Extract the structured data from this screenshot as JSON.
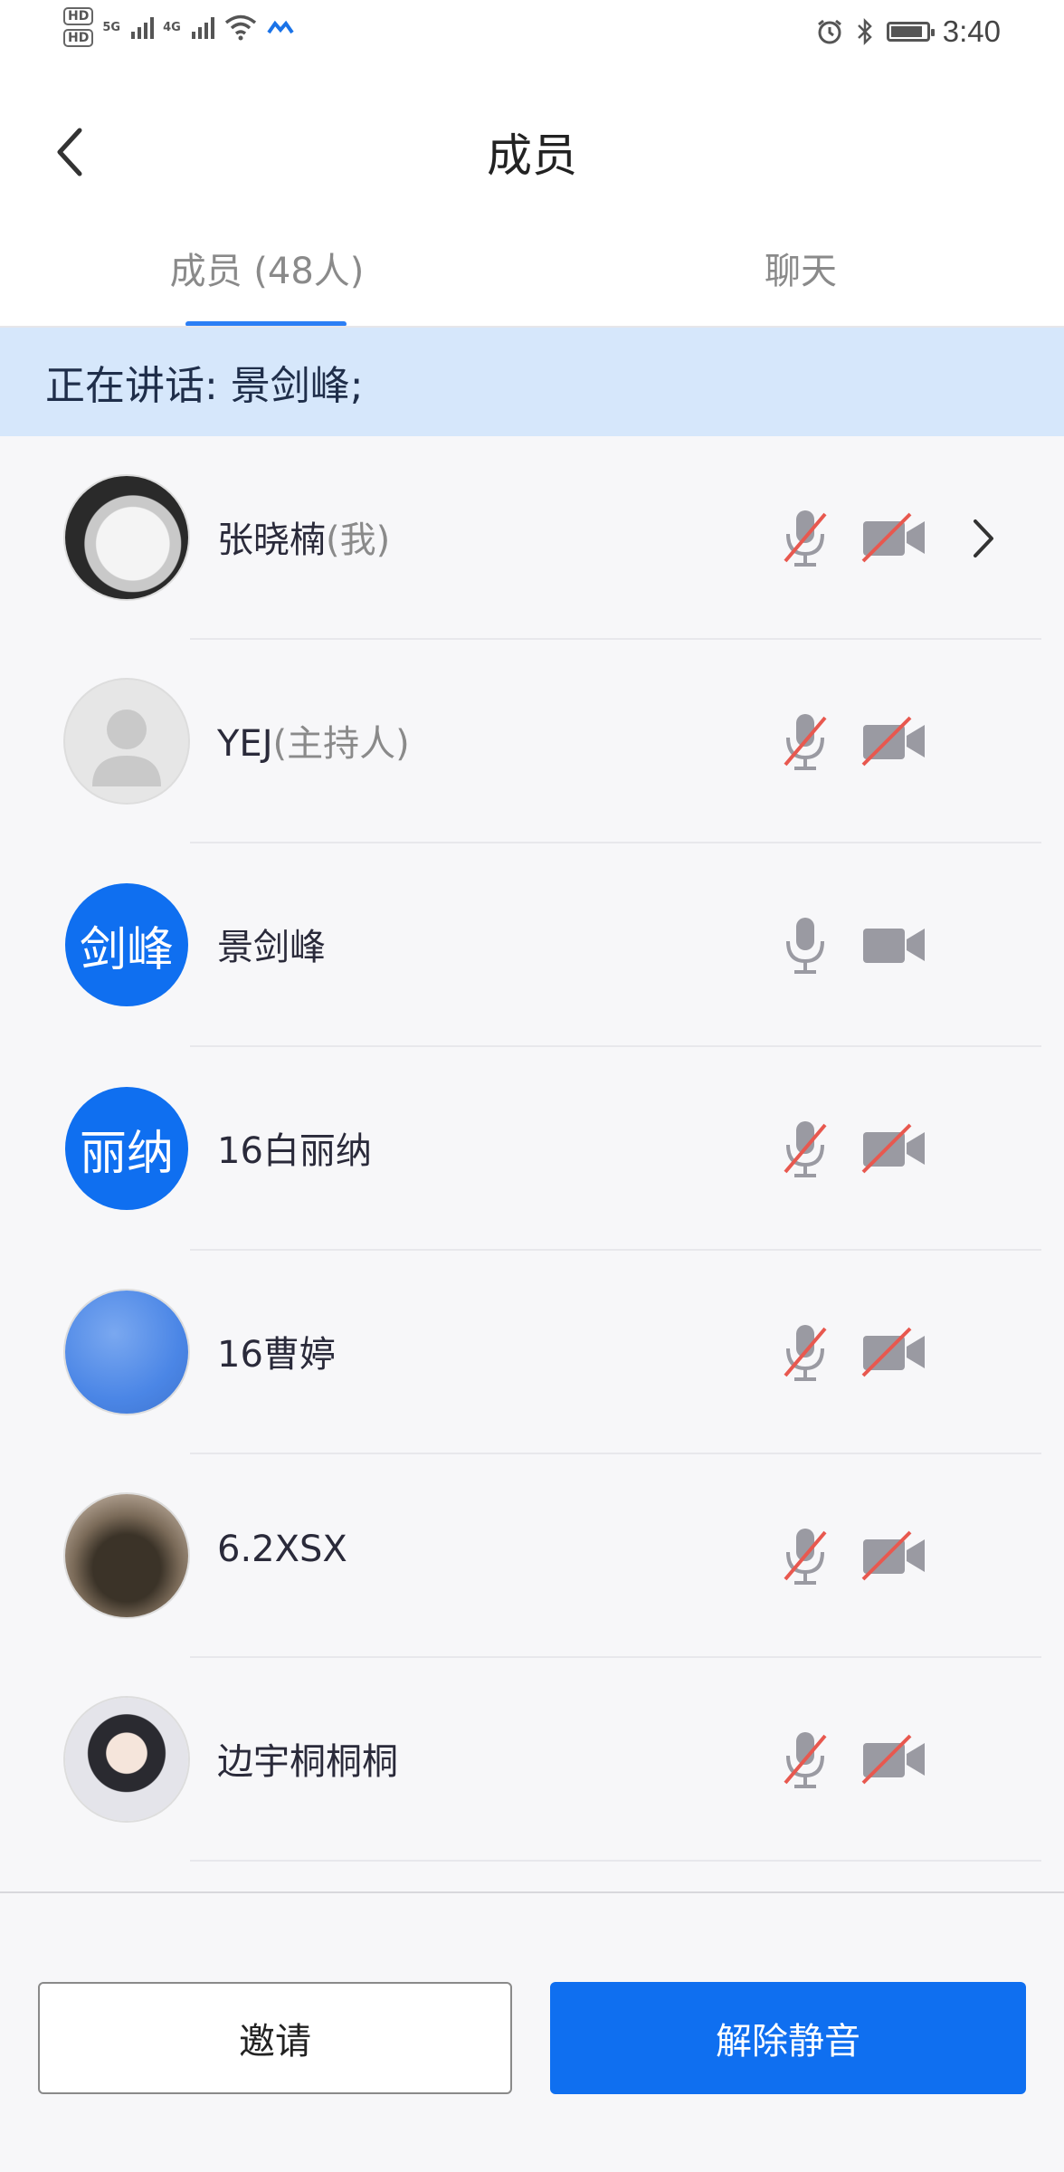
{
  "status_bar": {
    "hd1": "HD",
    "hd2": "HD",
    "signal1": "5G",
    "signal2": "4G",
    "time": "3:40",
    "icons": [
      "wifi-icon",
      "alarm-icon",
      "bluetooth-icon",
      "battery-icon"
    ]
  },
  "header": {
    "title": "成员",
    "back_icon": "chevron-left-icon"
  },
  "tabs": [
    {
      "label": "成员 (48人)",
      "active": true
    },
    {
      "label": "聊天",
      "active": false
    }
  ],
  "speaking_banner": "正在讲话: 景剑峰;",
  "members": [
    {
      "name": "张晓楠",
      "role": "(我)",
      "avatar": "photo-cat",
      "mic": "muted",
      "camera": "off",
      "has_chevron": true
    },
    {
      "name": "YEJ",
      "role": "(主持人)",
      "avatar": "default-person",
      "mic": "muted",
      "camera": "off",
      "has_chevron": false
    },
    {
      "name": "景剑峰",
      "role": "",
      "avatar_text": "剑峰",
      "mic": "on",
      "camera": "on",
      "has_chevron": false
    },
    {
      "name": "16白丽纳",
      "role": "",
      "avatar_text": "丽纳",
      "mic": "muted",
      "camera": "off",
      "has_chevron": false
    },
    {
      "name": "16曹婷",
      "role": "",
      "avatar": "photo-sky",
      "mic": "muted",
      "camera": "off",
      "has_chevron": false
    },
    {
      "name": "6.2XSX",
      "role": "",
      "avatar": "photo-tree",
      "mic": "muted",
      "camera": "off",
      "has_chevron": false
    },
    {
      "name": "边宇桐桐桐",
      "role": "",
      "avatar": "photo-girl",
      "mic": "muted",
      "camera": "off",
      "has_chevron": false
    }
  ],
  "buttons": {
    "invite": "邀请",
    "unmute": "解除静音"
  },
  "colors": {
    "accent": "#0f6ff0",
    "banner_bg": "#d6e7fb",
    "muted_slash": "#e8584f",
    "icon_gray": "#9a9aa2"
  }
}
